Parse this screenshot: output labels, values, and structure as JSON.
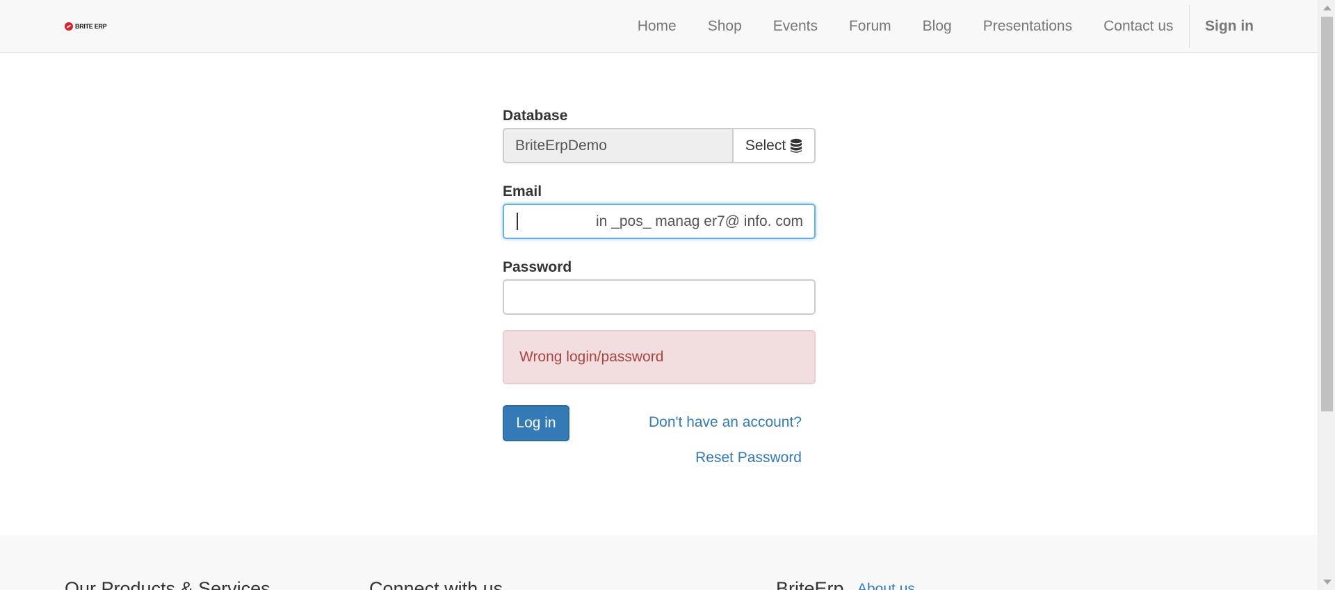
{
  "navbar": {
    "logo_text": "BRITE ERP",
    "items": [
      {
        "label": "Home"
      },
      {
        "label": "Shop"
      },
      {
        "label": "Events"
      },
      {
        "label": "Forum"
      },
      {
        "label": "Blog"
      },
      {
        "label": "Presentations"
      },
      {
        "label": "Contact us"
      }
    ],
    "signin": "Sign in"
  },
  "form": {
    "database_label": "Database",
    "database_value": "BriteErpDemo",
    "select_label": "Select",
    "select_icon": "database-icon",
    "email_label": "Email",
    "email_value": "in _pos_ manag er7@ info. com",
    "password_label": "Password",
    "password_value": "",
    "error_message": "Wrong login/password",
    "login_button": "Log in",
    "signup_link": "Don't have an account?",
    "reset_link": "Reset Password"
  },
  "footer": {
    "products_heading": "Our Products & Services",
    "connect_heading": "Connect with us",
    "brand_heading": "BriteErp",
    "about_link": "About us"
  },
  "colors": {
    "primary": "#337ab7",
    "error_bg": "#f2dede",
    "error_text": "#a94442",
    "navbar_bg": "#f8f8f8"
  }
}
